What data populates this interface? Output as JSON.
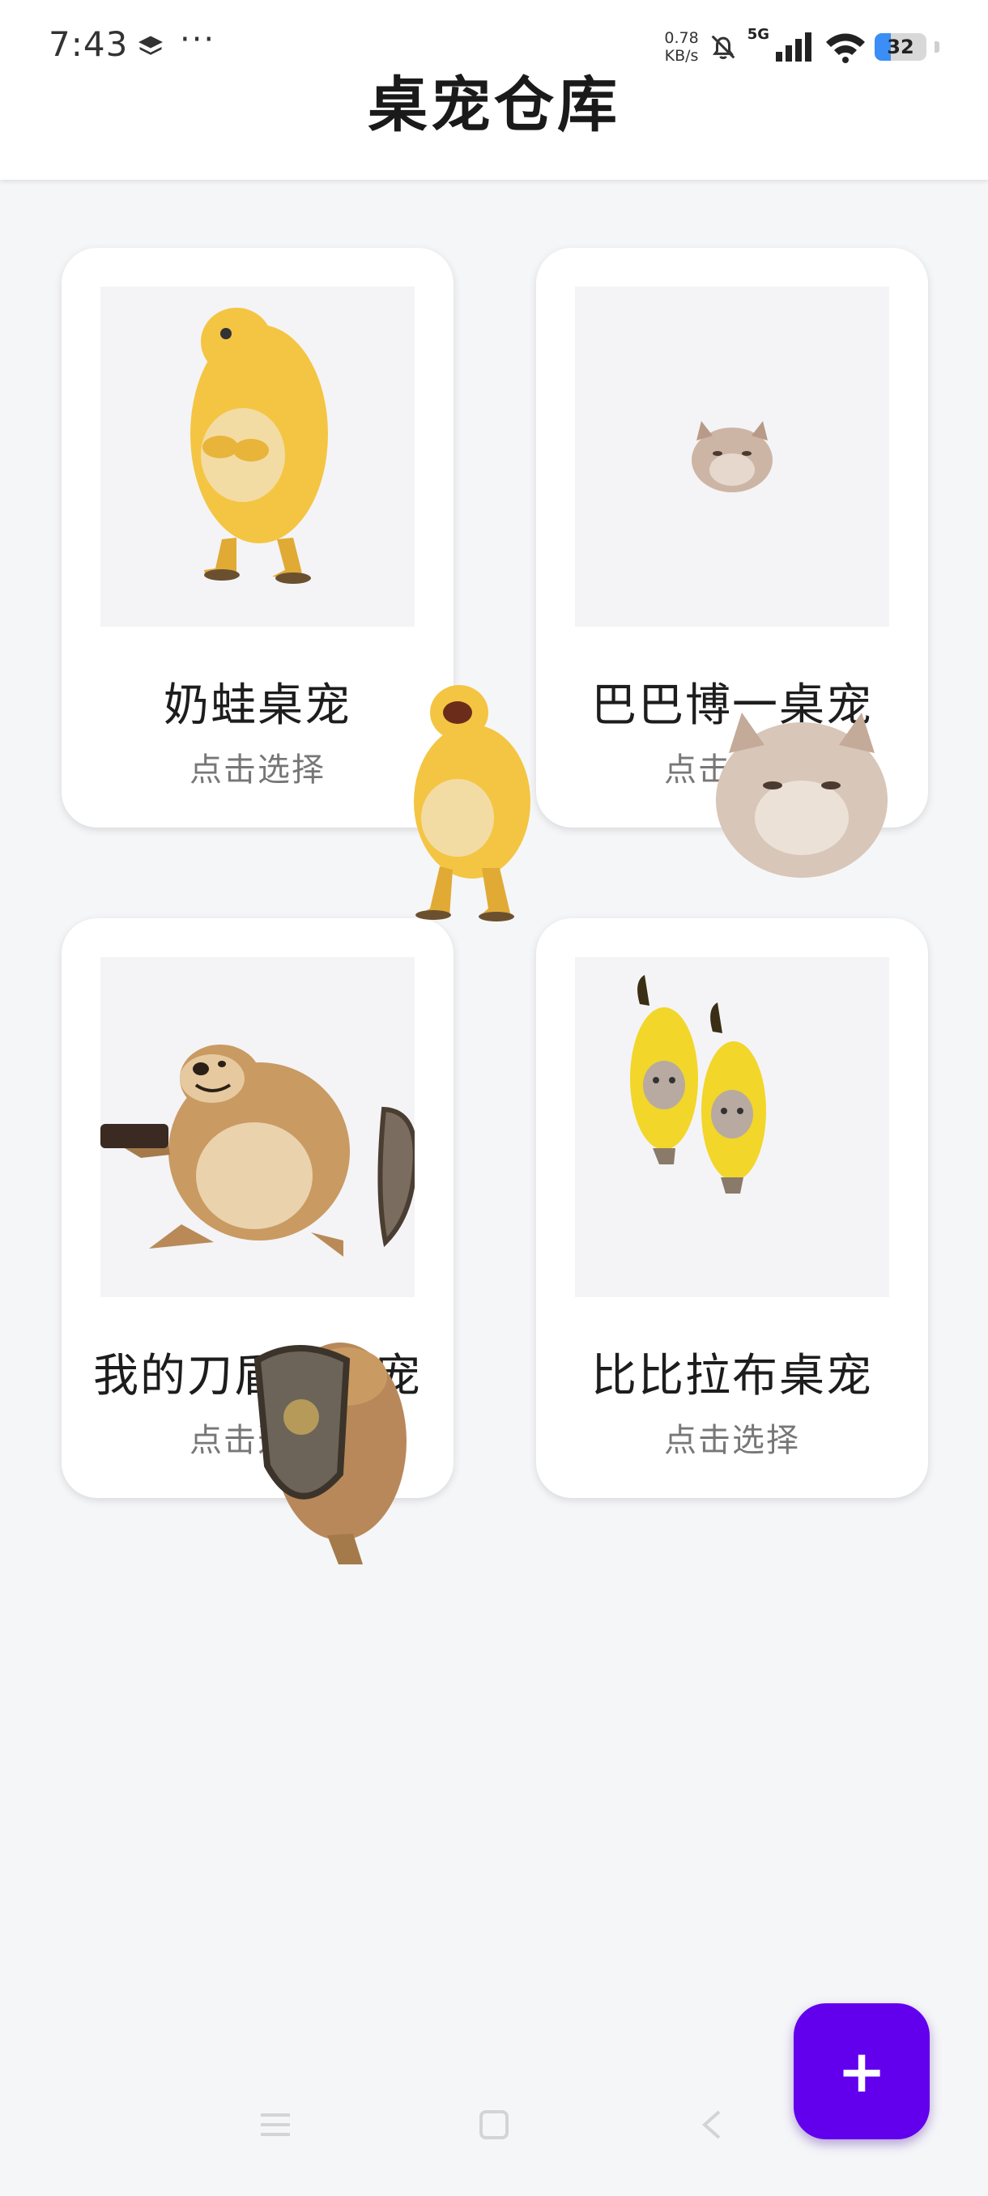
{
  "status_bar": {
    "time": "7:43",
    "dots": "···",
    "net_speed_value": "0.78",
    "net_speed_unit": "KB/s",
    "signal_label": "5G",
    "battery_level": "32",
    "battery_fraction": 0.32,
    "icons": [
      "layers-icon",
      "bell-muted-icon",
      "signal-icon",
      "wifi-icon",
      "battery-icon"
    ]
  },
  "header": {
    "title": "桌宠仓库"
  },
  "pets": [
    {
      "title": "奶蛙桌宠",
      "subtitle": "点击选择",
      "image": "yellow-frog-figure"
    },
    {
      "title": "巴巴博一桌宠",
      "subtitle": "点击选择",
      "image": "hamster-cat"
    },
    {
      "title": "我的刀盾狗桌宠",
      "subtitle": "点击选择",
      "image": "shield-doge"
    },
    {
      "title": "比比拉布桌宠",
      "subtitle": "点击选择",
      "image": "banana-cats"
    }
  ],
  "fab": {
    "label": "+"
  },
  "nav_bar": {
    "icons": [
      "menu-icon",
      "home-icon",
      "back-icon"
    ]
  },
  "colors": {
    "accent": "#6200ee",
    "background": "#f5f6f8",
    "card": "#ffffff"
  }
}
